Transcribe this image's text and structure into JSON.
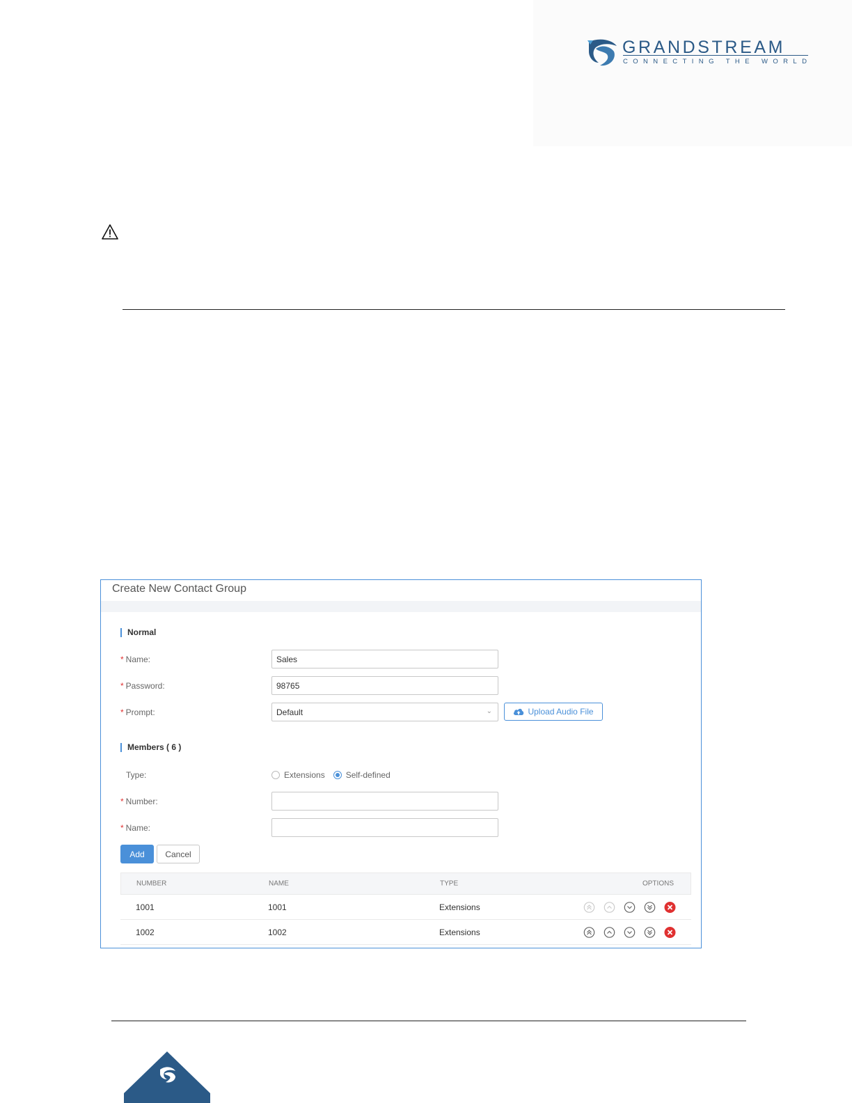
{
  "brand": {
    "name": "GRANDSTREAM",
    "tagline": "CONNECTING THE WORLD",
    "color": "#2b5a87"
  },
  "dialog": {
    "title": "Create New Contact Group",
    "normal_section": "Normal",
    "name_label": "Name:",
    "name_value": "Sales",
    "password_label": "Password:",
    "password_value": "98765",
    "prompt_label": "Prompt:",
    "prompt_value": "Default",
    "upload_label": "Upload Audio File",
    "members_section": "Members ( 6 )",
    "type_label": "Type:",
    "type_options": [
      "Extensions",
      "Self-defined"
    ],
    "type_selected": "Self-defined",
    "number_label": "Number:",
    "number_value": "",
    "member_name_label": "Name:",
    "member_name_value": "",
    "add_label": "Add",
    "cancel_label": "Cancel",
    "accent": "#4a90d9"
  },
  "table": {
    "columns": [
      "NUMBER",
      "NAME",
      "TYPE",
      "OPTIONS"
    ],
    "rows": [
      {
        "number": "1001",
        "name": "1001",
        "type": "Extensions"
      },
      {
        "number": "1002",
        "name": "1002",
        "type": "Extensions"
      }
    ],
    "option_icons": [
      "move-top-icon",
      "move-up-icon",
      "move-down-icon",
      "move-bottom-icon",
      "delete-icon"
    ]
  }
}
